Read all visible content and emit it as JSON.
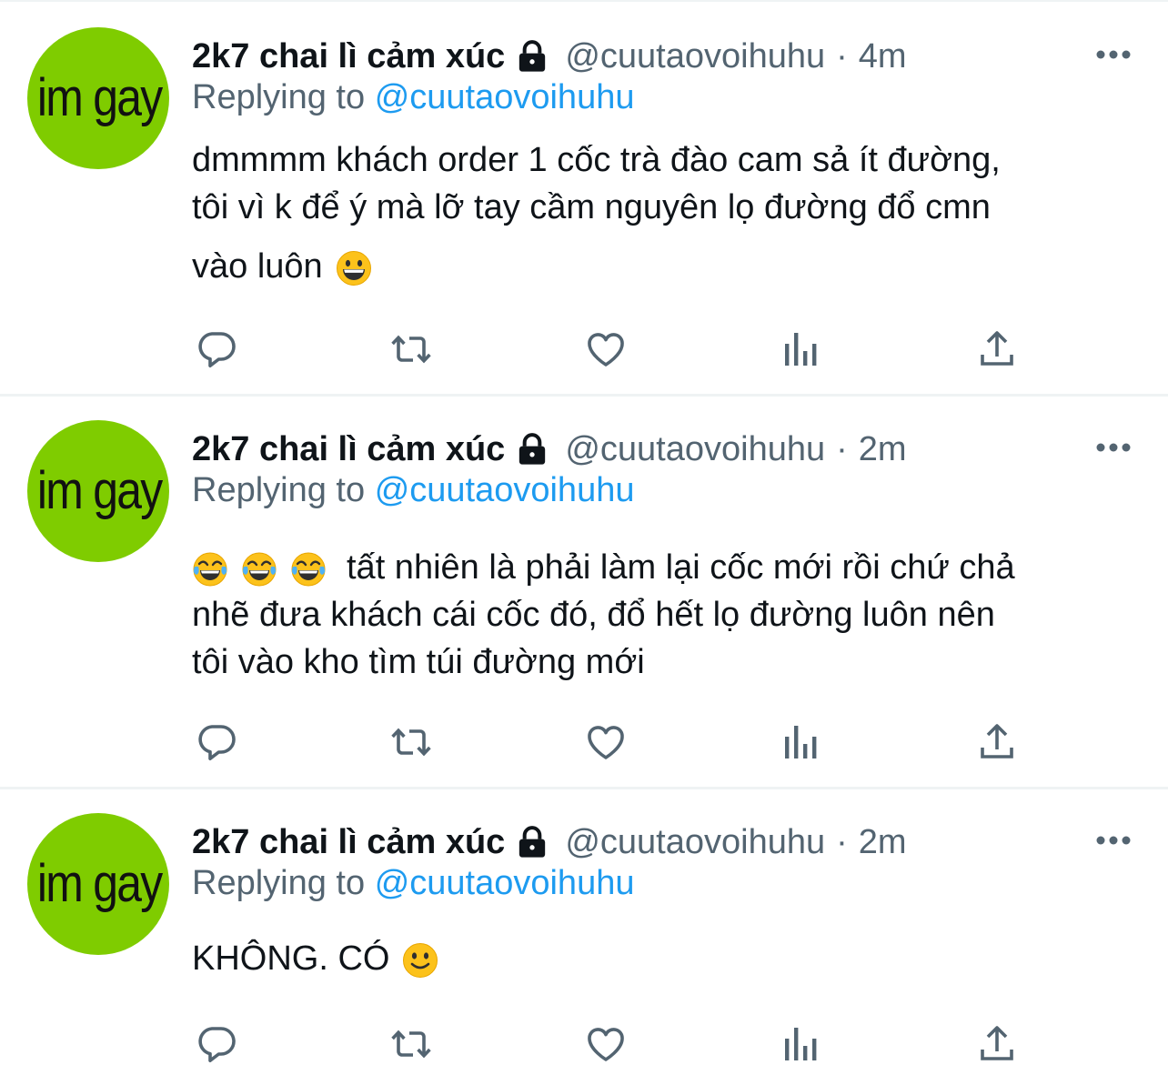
{
  "tweets": [
    {
      "avatar_text": "im gay",
      "display_name": "2k7 chai lì cảm xúc",
      "handle": "@cuutaovoihuhu",
      "separator": "·",
      "time": "4m",
      "replying_label": "Replying to",
      "replying_handle": "@cuutaovoihuhu",
      "text_lines": [
        "dmmmm khách order 1 cốc trà đào cam sả ít đường,",
        "tôi vì k để ý mà lỡ tay cầm nguyên lọ đường đổ cmn",
        "vào luôn"
      ],
      "emoji": "grinning-face"
    },
    {
      "avatar_text": "im gay",
      "display_name": "2k7 chai lì cảm xúc",
      "handle": "@cuutaovoihuhu",
      "separator": "·",
      "time": "2m",
      "replying_label": "Replying to",
      "replying_handle": "@cuutaovoihuhu",
      "text_lines": [
        "tất nhiên là phải làm lại cốc mới rồi chứ chả",
        "nhẽ đưa khách cái cốc đó, đổ hết lọ đường luôn nên",
        "tôi vào kho tìm túi đường mới"
      ],
      "emoji": "tears-of-joy-face x3"
    },
    {
      "avatar_text": "im gay",
      "display_name": "2k7 chai lì cảm xúc",
      "handle": "@cuutaovoihuhu",
      "separator": "·",
      "time": "2m",
      "replying_label": "Replying to",
      "replying_handle": "@cuutaovoihuhu",
      "text_lines": [
        "KHÔNG. CÓ"
      ],
      "emoji": "slightly-smiling-face"
    }
  ],
  "icons": {
    "reply": "reply-icon",
    "retweet": "retweet-icon",
    "like": "heart-icon",
    "views": "analytics-icon",
    "share": "share-icon",
    "more": "more-icon",
    "lock": "lock-icon"
  },
  "colors": {
    "text_primary": "#0f1419",
    "text_secondary": "#536471",
    "link": "#1d9bf0",
    "avatar_bg": "#7fcc00",
    "divider": "#eff3f4"
  }
}
